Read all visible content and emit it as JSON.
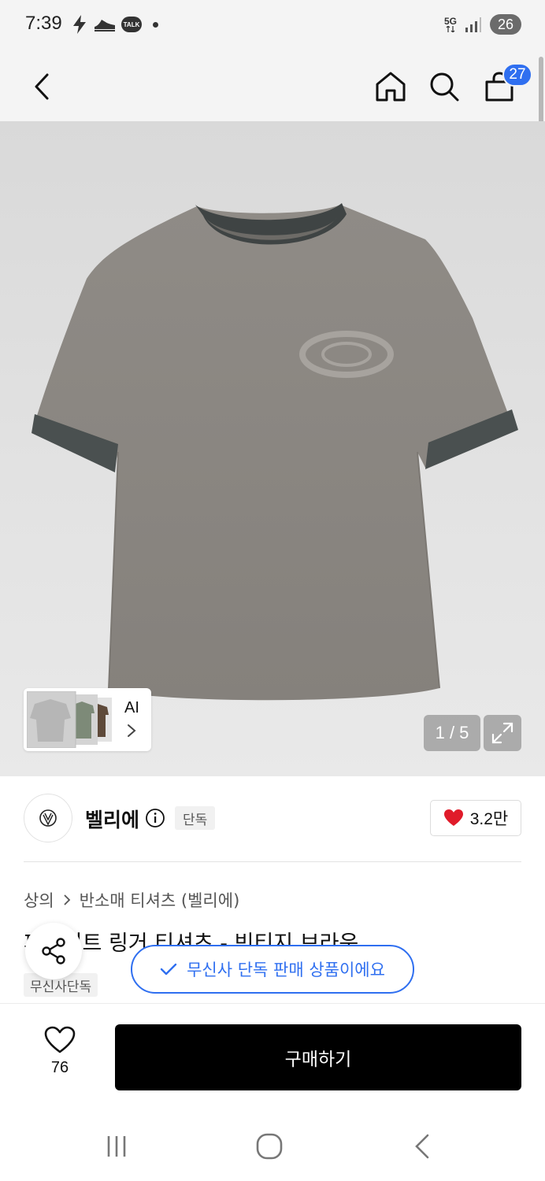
{
  "status_bar": {
    "time": "7:39",
    "talk_label": "TALK",
    "network_label": "5G",
    "battery": "26"
  },
  "header": {
    "cart_count": "27"
  },
  "gallery": {
    "ai_label": "AI",
    "page_counter": "1 / 5"
  },
  "brand": {
    "name": "벨리에",
    "exclusive_tag": "단독",
    "likes": "3.2만"
  },
  "product": {
    "category": [
      "상의",
      "반소매 티셔츠 (벨리에)"
    ],
    "title": "피그먼트 링거 티셔츠 - 빈티지 브라운",
    "badge": "무신사단독"
  },
  "toast": {
    "text": "무신사 단독 판매 상품이에요"
  },
  "action_bar": {
    "wish_count": "76",
    "buy_label": "구매하기"
  },
  "colors": {
    "accent": "#2f6ff0",
    "like_heart": "#e01b2a",
    "buy_button": "#000000"
  }
}
